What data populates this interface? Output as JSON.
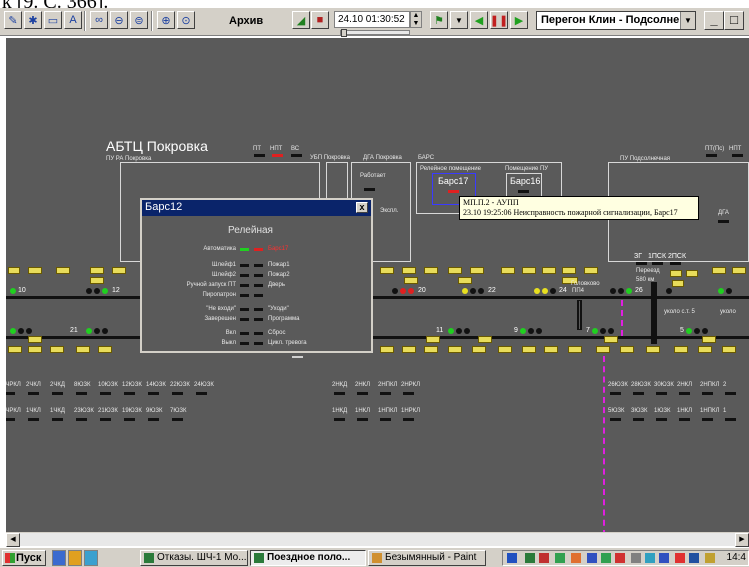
{
  "caption": "к [9. С. 366].",
  "toolbar": {
    "mode_label": "Архив",
    "datetime": "24.10  01:30:52",
    "station_selector": "Перегон Клин - Подсолне",
    "icons": [
      "text-edit-icon",
      "tools-icon",
      "panel-icon",
      "text-a-icon",
      "link-icon",
      "station-1-icon",
      "station-2-icon",
      "zoom-in-icon",
      "zoom-out-icon",
      "record-icon",
      "save-icon",
      "flag-icon",
      "dropdown-icon",
      "rewind-icon",
      "pause-icon",
      "play-icon"
    ],
    "win_buttons": [
      "_",
      "□",
      "x"
    ]
  },
  "scheme": {
    "station_title": "АБТЦ Покровка",
    "pu_ra_label": "ПУ РА Покровка",
    "indicators": [
      "ПТ",
      "НПТ",
      "ВС"
    ],
    "ubp_label": "УБП Покровка",
    "dga_pokrovka": "ДГА Покровка",
    "bars_label": "БАРС",
    "rel_room": "Релейное помещение",
    "pu_room": "Помещение ПУ",
    "bars17": "Барс17",
    "bars16": "Барс16",
    "works_label": "Работает",
    "expl_label": "Экспл.",
    "pu_podsol": "ПУ Подсолнечная",
    "ptps": "ПТ(Пс)",
    "npt_right": "НПТ",
    "dga_right": "ДГА",
    "signal_box": [
      "ЗГ",
      "1ПСК",
      "2ПСК"
    ],
    "crossing": "Переезд",
    "crossing_km": "580 км",
    "golovkovo": "Головково",
    "ukolo_left": "уколо с.т. 5",
    "ukolo_right": "уколо",
    "pp4": "ПП4",
    "track_nums_top": [
      "10",
      "12",
      "20",
      "22",
      "24",
      "26"
    ],
    "track_nums_bottom": [
      "21",
      "11",
      "9",
      "7",
      "5"
    ],
    "labels_left_top": [
      "2ЧРКЛ",
      "2ЧКЛ",
      "2ЧКД",
      "8ЮЗК",
      "10ЮЗК",
      "12ЮЗК",
      "14ЮЗК",
      "22ЮЗК",
      "24ЮЗК"
    ],
    "labels_left_bottom": [
      "1ЧРКЛ",
      "1ЧКЛ",
      "1ЧКД",
      "23ЮЗК",
      "21ЮЗК",
      "19ЮЗК",
      "9ЮЗК",
      "7ЮЗК"
    ],
    "labels_mid_top": [
      "2НКД",
      "2НКЛ",
      "2НПКЛ",
      "2НРКЛ"
    ],
    "labels_mid_bottom": [
      "1НКД",
      "1НКЛ",
      "1НПКЛ",
      "1НРКЛ"
    ],
    "labels_right_top": [
      "26ЮЗК",
      "28ЮЗК",
      "30ЮЗК",
      "2НКЛ",
      "2НПКЛ",
      "2"
    ],
    "labels_right_bottom": [
      "5ЮЗК",
      "3ЮЗК",
      "1ЮЗК",
      "1НКЛ",
      "1НПКЛ",
      "1"
    ]
  },
  "dialog": {
    "title": "Барс12",
    "heading": "Релейная",
    "rows": [
      {
        "left": "Автоматика",
        "right": "Барс17"
      },
      {
        "left": "Шлейф1",
        "right": "Пожар1"
      },
      {
        "left": "Шлейф2",
        "right": "Пожар2"
      },
      {
        "left": "Ручной запуск ПТ",
        "right": "Дверь"
      },
      {
        "left": "Пиропатрон",
        "right": ""
      },
      {
        "left": "\"Не входи\"",
        "right": "\"Уходи\""
      },
      {
        "left": "Заверешен",
        "right": "Программа"
      },
      {
        "left": "Вкл",
        "right": "Сброс"
      },
      {
        "left": "Выкл",
        "right": "Цикл. тревога"
      }
    ]
  },
  "tooltip": {
    "line1": "МП.П.2 - АУПП",
    "line2": "23.10 19:25:06 Неисправность пожарной сигнализации, Барс17"
  },
  "taskbar": {
    "start": "Пуск",
    "tasks": [
      "Отказы. ШЧ-1 Мо...",
      "Поездное поло...",
      "Безымянный - Paint"
    ],
    "clock": "14:4"
  },
  "colors": {
    "scheme_bg": "#5a5a5a",
    "alarm_red": "#e02020",
    "ok_green": "#20d020",
    "yellow": "#e8e020",
    "magenta": "#e020e0",
    "titlebar": "#0a246a",
    "tooltip_bg": "#ffffe1"
  }
}
